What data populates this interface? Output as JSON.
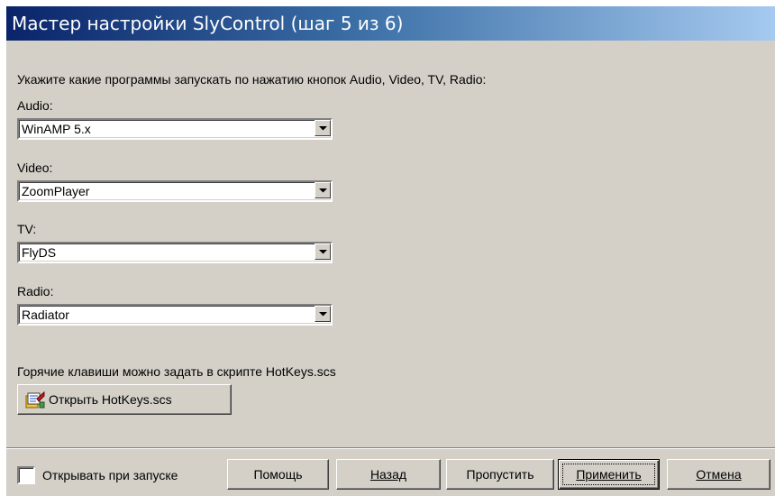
{
  "window": {
    "title": "Мастер настройки SlyControl (шаг 5 из 6)"
  },
  "main": {
    "instruction": "Укажите какие программы запускать по нажатию кнопок Audio, Video, TV, Radio:",
    "fields": [
      {
        "label": "Audio:",
        "value": "WinAMP 5.x"
      },
      {
        "label": "Video:",
        "value": "ZoomPlayer"
      },
      {
        "label": "TV:",
        "value": "FlyDS"
      },
      {
        "label": "Radio:",
        "value": "Radiator"
      }
    ],
    "hotkeys_note": "Горячие клавиши можно задать в скрипте HotKeys.scs",
    "open_hotkeys_label": "Открыть HotKeys.scs"
  },
  "footer": {
    "startup_checkbox_label": "Открывать при запуске",
    "startup_checked": false,
    "help_label": "Помощь",
    "back_label": "Назад",
    "skip_label": "Пропустить",
    "apply_label": "Применить",
    "cancel_label": "Отмена"
  },
  "icons": {
    "open_hotkeys": "script-file-icon",
    "dropdown": "chevron-down-icon"
  }
}
